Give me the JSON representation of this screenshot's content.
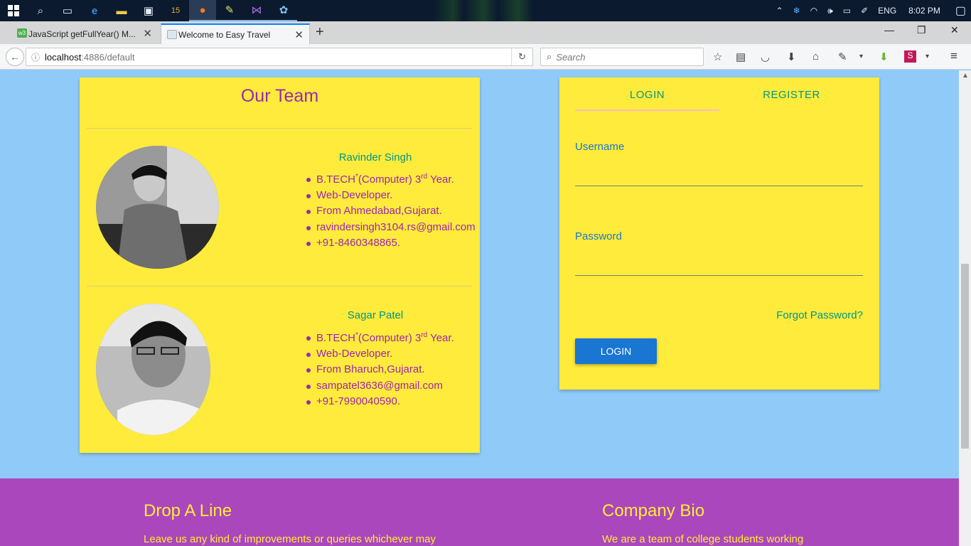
{
  "taskbar": {
    "tray": {
      "language": "ENG",
      "time": "8:02 PM"
    }
  },
  "browser": {
    "tabs": [
      {
        "title": "JavaScript getFullYear() M...",
        "favicon": "w3"
      },
      {
        "title": "Welcome to Easy Travel"
      }
    ],
    "url_host": "localhost",
    "url_path": ":4886/default",
    "search_placeholder": "Search"
  },
  "team": {
    "title": "Our Team",
    "members": [
      {
        "name": "Ravinder Singh",
        "details": [
          "Web-Developer.",
          "From Ahmedabad,Gujarat.",
          "ravindersingh3104.rs@gmail.com",
          "+91-8460348865."
        ]
      },
      {
        "name": "Sagar Patel",
        "details": [
          "Web-Developer.",
          "From Bharuch,Gujarat.",
          "sampatel3636@gmail.com",
          "+91-7990040590."
        ]
      }
    ]
  },
  "login_card": {
    "tabs": [
      "LOGIN",
      "REGISTER"
    ],
    "username_label": "Username",
    "password_label": "Password",
    "forgot": "Forgot Password?",
    "button": "LOGIN"
  },
  "footer": {
    "left_title": "Drop A Line",
    "left_text": "Leave us any kind of improvements or queries whichever may",
    "right_title": "Company Bio",
    "right_text": "We are a team of college students working"
  }
}
